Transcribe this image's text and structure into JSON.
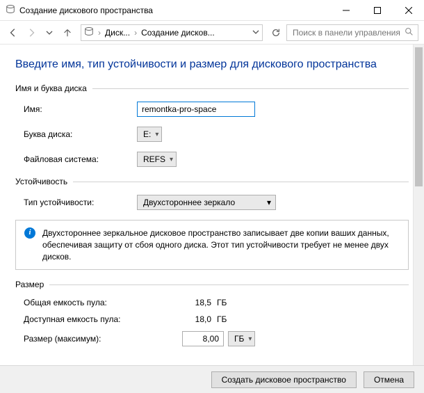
{
  "window": {
    "title": "Создание дискового пространства"
  },
  "breadcrumb": {
    "segment1": "Диск...",
    "segment2": "Создание дисков..."
  },
  "search": {
    "placeholder": "Поиск в панели управления"
  },
  "heading": "Введите имя, тип устойчивости и размер для дискового пространства",
  "group_name": {
    "legend": "Имя и буква диска",
    "name_label": "Имя:",
    "name_value": "remontka-pro-space",
    "letter_label": "Буква диска:",
    "letter_value": "E:",
    "fs_label": "Файловая система:",
    "fs_value": "REFS"
  },
  "group_resilience": {
    "legend": "Устойчивость",
    "type_label": "Тип устойчивости:",
    "type_value": "Двухстороннее зеркало",
    "info_text": "Двухстороннее зеркальное дисковое пространство записывает две копии ваших данных, обеспечивая защиту от сбоя одного диска. Этот тип устойчивости требует не менее двух дисков."
  },
  "group_size": {
    "legend": "Размер",
    "total_label": "Общая емкость пула:",
    "total_value": "18,5",
    "total_unit": "ГБ",
    "avail_label": "Доступная емкость пула:",
    "avail_value": "18,0",
    "avail_unit": "ГБ",
    "max_label": "Размер (максимум):",
    "max_value": "8,00",
    "max_unit": "ГБ"
  },
  "footer": {
    "create": "Создать дисковое пространство",
    "cancel": "Отмена"
  }
}
